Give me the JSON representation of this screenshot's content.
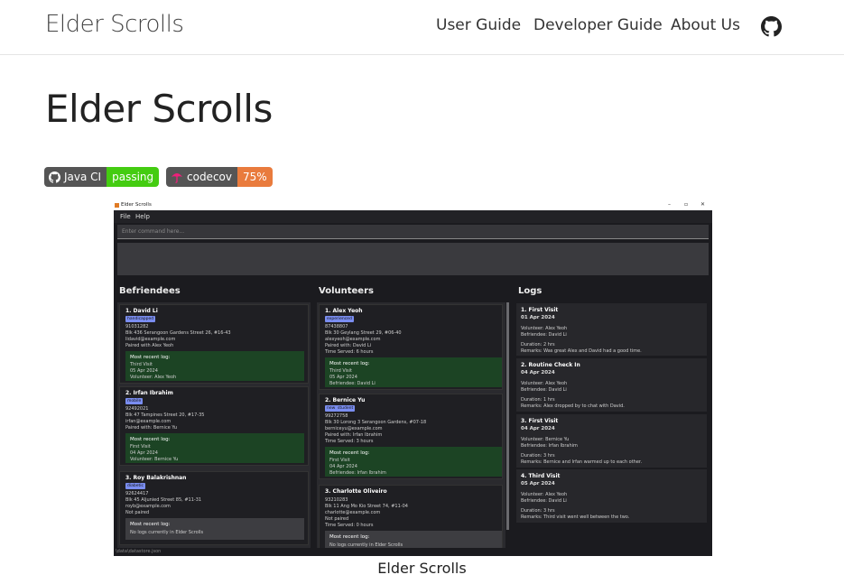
{
  "nav": {
    "brand": "Elder Scrolls",
    "links": [
      "User Guide",
      "Developer Guide",
      "About Us"
    ]
  },
  "page": {
    "title": "Elder Scrolls",
    "caption": "Elder Scrolls"
  },
  "badges": [
    {
      "label": "Java CI",
      "value": "passing",
      "color": "#44cc11"
    },
    {
      "label": "codecov",
      "value": "75%",
      "color": "#e05d44"
    }
  ],
  "app": {
    "window_title": "Elder Scrolls",
    "menu": [
      "File",
      "Help"
    ],
    "command_placeholder": "Enter command here...",
    "columns": [
      "Befriendees",
      "Volunteers",
      "Logs"
    ],
    "status_path": "\\data\\datastore.json",
    "befriendees": [
      {
        "name": "1.  David Li",
        "tags": [
          "handicapped"
        ],
        "lines": [
          "91031282",
          "Blk 436 Serangoon Gardens Street 26, #16-43",
          "lidavid@example.com",
          "Paired with Alex Yeoh"
        ],
        "log_title": "Most recent log:",
        "log": [
          "Third Visit",
          "05 Apr 2024",
          "Volunteer: Alex Yeoh"
        ]
      },
      {
        "name": "2.  Irfan Ibrahim",
        "tags": [
          "mobile"
        ],
        "lines": [
          "92492021",
          "Blk 47 Tampines Street 20, #17-35",
          "irfan@example.com",
          "Paired with: Bernice Yu"
        ],
        "log_title": "Most recent log:",
        "log": [
          "First Visit",
          "04 Apr 2024",
          "Volunteer: Bernice Yu"
        ]
      },
      {
        "name": "3.  Roy Balakrishnan",
        "tags": [
          "diabetic"
        ],
        "lines": [
          "92624417",
          "Blk 45 Aljunied Street 85, #11-31",
          "royb@example.com",
          "Not paired"
        ],
        "log_title": "Most recent log:",
        "log": [
          "No logs currently in Elder Scrolls"
        ]
      }
    ],
    "volunteers": [
      {
        "name": "1.  Alex Yeoh",
        "tags": [
          "experienced"
        ],
        "lines": [
          "87438807",
          "Blk 30 Geylang Street 29, #06-40",
          "alexyeoh@example.com",
          "Paired with: David Li",
          "Time Served: 6 hours"
        ],
        "log_title": "Most recent log:",
        "log": [
          "Third Visit",
          "05 Apr 2024",
          "Befriendee: David Li"
        ]
      },
      {
        "name": "2.  Bernice Yu",
        "tags": [
          "new",
          "student"
        ],
        "lines": [
          "99272758",
          "Blk 30 Lorong 3 Serangoon Gardens, #07-18",
          "berniceyu@example.com",
          "Paired with: Irfan Ibrahim",
          "Time Served: 3 hours"
        ],
        "log_title": "Most recent log:",
        "log": [
          "First Visit",
          "04 Apr 2024",
          "Befriendee: Irfan Ibrahim"
        ]
      },
      {
        "name": "3.  Charlotte Oliveiro",
        "tags": [],
        "lines": [
          "93210283",
          "Blk 11 Ang Mo Kio Street 74, #11-04",
          "charlotte@example.com",
          "Not paired",
          "Time Served: 0 hours"
        ],
        "log_title": "Most recent log:",
        "log": [
          "No logs currently in Elder Scrolls"
        ]
      }
    ],
    "logs": [
      {
        "title": "1.  First Visit",
        "date": "01 Apr 2024",
        "lines": [
          "Volunteer: Alex Yeoh",
          "Befriendee: David Li",
          "Duration: 2 hrs",
          "Remarks: Was great Alex and David had a good time."
        ]
      },
      {
        "title": "2.  Routine Check In",
        "date": "04 Apr 2024",
        "lines": [
          "Volunteer: Alex Yeoh",
          "Befriendee: David Li",
          "Duration: 1 hrs",
          "Remarks: Alex dropped by to chat with David."
        ]
      },
      {
        "title": "3.  First Visit",
        "date": "04 Apr 2024",
        "lines": [
          "Volunteer: Bernice Yu",
          "Befriendee: Irfan Ibrahim",
          "Duration: 3 hrs",
          "Remarks: Bernice and Irfan warmed up to each other."
        ]
      },
      {
        "title": "4.  Third Visit",
        "date": "05 Apr 2024",
        "lines": [
          "Volunteer: Alex Yeoh",
          "Befriendee: David Li",
          "Duration: 3 hrs",
          "Remarks: Third visit went well between the two."
        ]
      }
    ]
  }
}
